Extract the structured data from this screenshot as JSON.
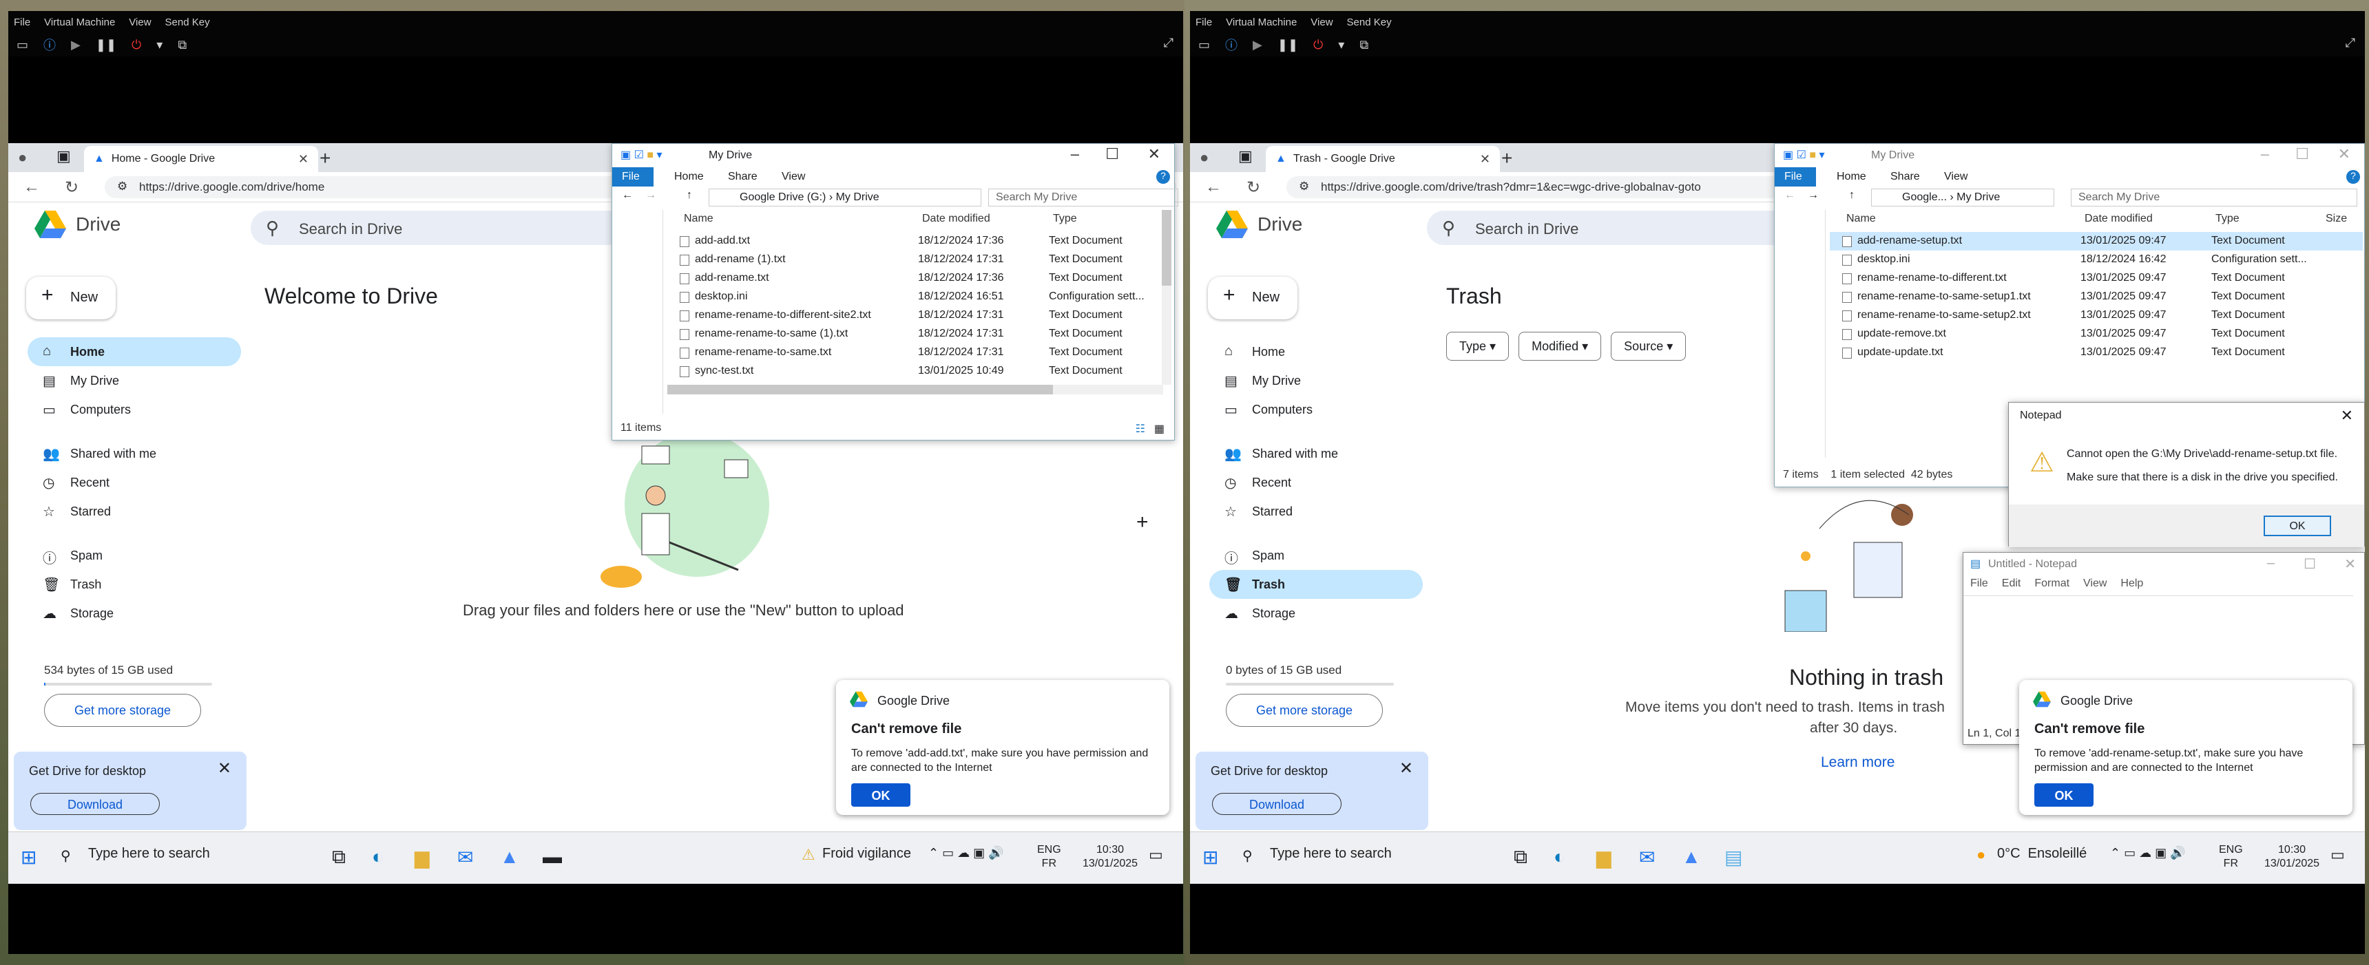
{
  "vm_menu": [
    "File",
    "Virtual Machine",
    "View",
    "Send Key"
  ],
  "left": {
    "tab_title": "Home - Google Drive",
    "url": "https://drive.google.com/drive/home",
    "drive_label": "Drive",
    "search_placeholder": "Search in Drive",
    "new_label": "New",
    "nav": [
      "Home",
      "My Drive",
      "Computers",
      "Shared with me",
      "Recent",
      "Starred",
      "Spam",
      "Trash",
      "Storage"
    ],
    "storage_text": "534 bytes of 15 GB used",
    "get_more": "Get more storage",
    "promo_title": "Get Drive for desktop",
    "download": "Download",
    "welcome": "Welcome to Drive",
    "empty_msg": "Drag your files and folders here or use the \"New\" button to upload",
    "explorer": {
      "title": "My Drive",
      "tabs": [
        "File",
        "Home",
        "Share",
        "View"
      ],
      "path": "Google Drive (G:)  ›  My Drive",
      "search": "Search My Drive",
      "cols": [
        "Name",
        "Date modified",
        "Type"
      ],
      "rows": [
        {
          "name": "add-add.txt",
          "date": "18/12/2024 17:36",
          "type": "Text Document"
        },
        {
          "name": "add-rename (1).txt",
          "date": "18/12/2024 17:31",
          "type": "Text Document"
        },
        {
          "name": "add-rename.txt",
          "date": "18/12/2024 17:36",
          "type": "Text Document"
        },
        {
          "name": "desktop.ini",
          "date": "18/12/2024 16:51",
          "type": "Configuration sett..."
        },
        {
          "name": "rename-rename-to-different-site2.txt",
          "date": "18/12/2024 17:31",
          "type": "Text Document"
        },
        {
          "name": "rename-rename-to-same (1).txt",
          "date": "18/12/2024 17:31",
          "type": "Text Document"
        },
        {
          "name": "rename-rename-to-same.txt",
          "date": "18/12/2024 17:31",
          "type": "Text Document"
        },
        {
          "name": "sync-test.txt",
          "date": "13/01/2025 10:49",
          "type": "Text Document"
        }
      ],
      "status": "11 items"
    },
    "toast": {
      "app": "Google Drive",
      "title": "Can't remove file",
      "msg": "To remove 'add-add.txt', make sure you have permission and are connected to the Internet",
      "ok": "OK"
    },
    "taskbar": {
      "search": "Type here to search",
      "weather": "Froid vigilance",
      "lang1": "ENG",
      "lang2": "FR",
      "time": "10:30",
      "date": "13/01/2025"
    }
  },
  "right": {
    "tab_title": "Trash - Google Drive",
    "url": "https://drive.google.com/drive/trash?dmr=1&ec=wgc-drive-globalnav-goto",
    "drive_label": "Drive",
    "search_placeholder": "Search in Drive",
    "new_label": "New",
    "nav": [
      "Home",
      "My Drive",
      "Computers",
      "Shared with me",
      "Recent",
      "Starred",
      "Spam",
      "Trash",
      "Storage"
    ],
    "storage_text": "0 bytes of 15 GB used",
    "get_more": "Get more storage",
    "promo_title": "Get Drive for desktop",
    "download": "Download",
    "trash_title": "Trash",
    "filters": [
      "Type",
      "Modified",
      "Source"
    ],
    "nothing": "Nothing in trash",
    "nothing_sub": "Move items you don't need to trash. Items in trash",
    "nothing_sub2": "after 30 days.",
    "learn_more": "Learn more",
    "explorer": {
      "title": "My Drive",
      "tabs": [
        "File",
        "Home",
        "Share",
        "View"
      ],
      "path": "Google...  ›  My Drive",
      "search": "Search My Drive",
      "cols": [
        "Name",
        "Date modified",
        "Type",
        "Size"
      ],
      "rows": [
        {
          "name": "add-rename-setup.txt",
          "date": "13/01/2025 09:47",
          "type": "Text Document"
        },
        {
          "name": "desktop.ini",
          "date": "18/12/2024 16:42",
          "type": "Configuration sett..."
        },
        {
          "name": "rename-rename-to-different.txt",
          "date": "13/01/2025 09:47",
          "type": "Text Document"
        },
        {
          "name": "rename-rename-to-same-setup1.txt",
          "date": "13/01/2025 09:47",
          "type": "Text Document"
        },
        {
          "name": "rename-rename-to-same-setup2.txt",
          "date": "13/01/2025 09:47",
          "type": "Text Document"
        },
        {
          "name": "update-remove.txt",
          "date": "13/01/2025 09:47",
          "type": "Text Document"
        },
        {
          "name": "update-update.txt",
          "date": "13/01/2025 09:47",
          "type": "Text Document"
        }
      ],
      "status": "7 items    1 item selected  42 bytes"
    },
    "notepad_err": {
      "title": "Notepad",
      "line1": "Cannot open the G:\\My Drive\\add-rename-setup.txt file.",
      "line2": "Make sure that there is a disk in the drive you specified.",
      "ok": "OK"
    },
    "notepad": {
      "title": "Untitled - Notepad",
      "menu": [
        "File",
        "Edit",
        "Format",
        "View",
        "Help"
      ],
      "status": "Ln 1, Col 1"
    },
    "toast": {
      "app": "Google Drive",
      "title": "Can't remove file",
      "msg": "To remove 'add-rename-setup.txt', make sure you have permission and are connected to the Internet",
      "ok": "OK"
    },
    "taskbar": {
      "search": "Type here to search",
      "weather": "0°C  Ensoleillé",
      "lang1": "ENG",
      "lang2": "FR",
      "time": "10:30",
      "date": "13/01/2025"
    }
  }
}
